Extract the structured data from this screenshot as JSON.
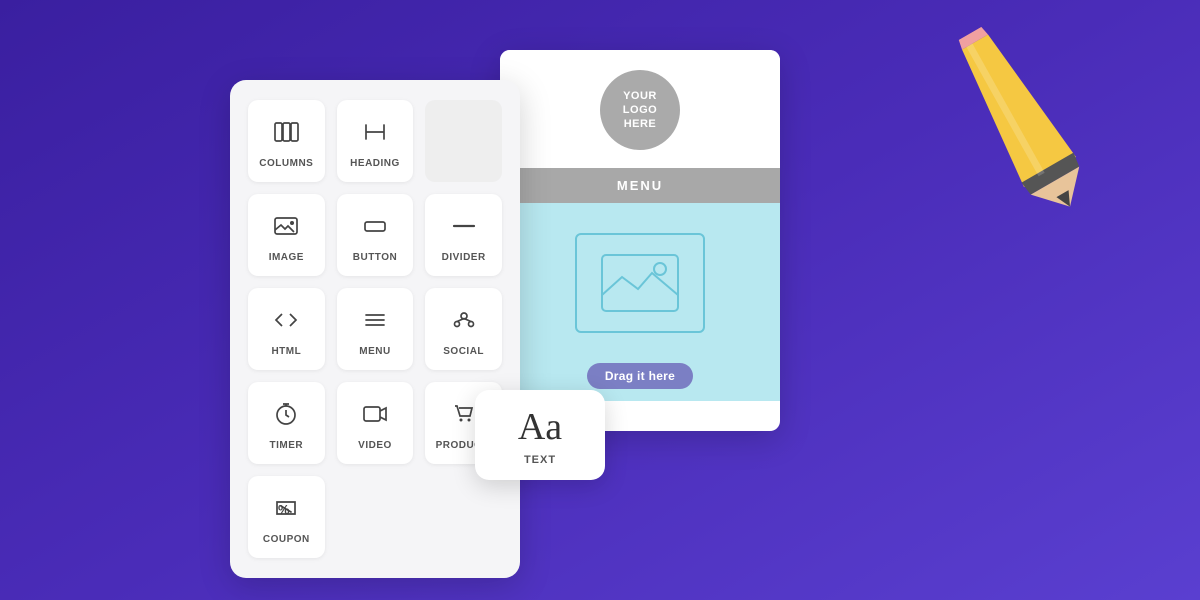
{
  "background": {
    "gradient_start": "#4a2cb8",
    "gradient_end": "#3a1fa0"
  },
  "widget_panel": {
    "items": [
      {
        "id": "columns",
        "label": "COLUMNS",
        "icon": "columns-icon"
      },
      {
        "id": "heading",
        "label": "HEADING",
        "icon": "heading-icon"
      },
      {
        "id": "empty",
        "label": "",
        "icon": ""
      },
      {
        "id": "image",
        "label": "IMAGE",
        "icon": "image-icon"
      },
      {
        "id": "button",
        "label": "BUTTON",
        "icon": "button-icon"
      },
      {
        "id": "divider",
        "label": "DIVIDER",
        "icon": "divider-icon"
      },
      {
        "id": "html",
        "label": "HTML",
        "icon": "html-icon"
      },
      {
        "id": "menu",
        "label": "MENU",
        "icon": "menu-icon"
      },
      {
        "id": "social",
        "label": "SOCIAL",
        "icon": "social-icon"
      },
      {
        "id": "timer",
        "label": "TIMER",
        "icon": "timer-icon"
      },
      {
        "id": "video",
        "label": "VIDEO",
        "icon": "video-icon"
      },
      {
        "id": "products",
        "label": "PRODUC...",
        "icon": "products-icon"
      },
      {
        "id": "coupon",
        "label": "COUPON",
        "icon": "coupon-icon"
      }
    ]
  },
  "email_preview": {
    "logo_text": "YOUR\nLOGO\nHERE",
    "menu_label": "MENU",
    "drag_label": "Drag it here"
  },
  "text_block": {
    "symbol": "Aa",
    "label": "TEXT"
  },
  "pencil": {
    "description": "pencil icon"
  }
}
